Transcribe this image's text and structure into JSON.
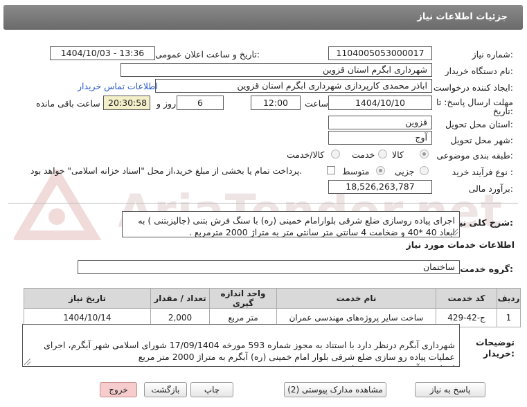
{
  "header": {
    "title": "جزئیات اطلاعات نیاز"
  },
  "watermark": {
    "text": "AriaTender.net"
  },
  "fields": {
    "need_number_label": "شماره نیاز:",
    "need_number": "1104005053000017",
    "announce_label": "تاریخ و ساعت اعلان عمومی:",
    "announce_value": "1404/10/03 - 13:36",
    "buyer_org_label": "نام دستگاه خریدار:",
    "buyer_org": "شهرداری ابگرم استان قزوین",
    "creator_label": "ایجاد کننده درخواست:",
    "creator": "اباذر محمدی کارپردازی شهرداری ابگرم استان قزوین",
    "contact_link": "اطلاعات تماس خریدار",
    "deadline_label_1": "مهلت ارسال پاسخ: تا",
    "deadline_label_2": "تاریخ:",
    "deadline_date": "1404/10/10",
    "time_label": "ساعت",
    "deadline_time": "12:00",
    "days_value": "6",
    "days_label": "روز و",
    "remaining_time": "20:30:58",
    "remaining_label": "ساعت باقی مانده",
    "province_label": "استان محل تحویل:",
    "province": "قزوین",
    "city_label": "شهر محل تحویل:",
    "city": "آوج",
    "category_label": "طبقه بندی موضوعی:",
    "category_options": [
      "کالا",
      "خدمت",
      "کالا/خدمت"
    ],
    "process_label": "نوع فرآیند خرید :",
    "process_options": [
      "جزیی",
      "متوسط"
    ],
    "payment_note": "پرداخت تمام یا بخشی از مبلغ خرید،از محل \"اسناد خزانه اسلامی\" خواهد بود.",
    "estimate_label": "برآورد مالی:",
    "estimate": "18,526,263,787"
  },
  "summary": {
    "label": "شرح کلی نیاز:",
    "text": "اجرای پیاده روسازی ضلع شرقی بلوارامام خمینی (ره) با سنگ فرش بتنی (جالیزبتنی ) به ابعاد 40 *40 و ضخامت 4 سانتی متر  سانتی متر به متراژ 2000 مترمربع ."
  },
  "services": {
    "section_title": "اطلاعات خدمات مورد نیاز",
    "group_label": "گروه خدمت:",
    "group_value": "ساختمان",
    "columns": [
      "ردیف",
      "کد خدمت",
      "نام خدمت",
      "واحد اندازه گیری",
      "تعداد / مقدار",
      "تاریخ نیاز"
    ],
    "rows": [
      [
        "1",
        "ج-42-429",
        "ساخت سایر پروژه‌های مهندسی عمران",
        "متر مربع",
        "2,000",
        "1404/10/14"
      ]
    ]
  },
  "buyer_notes": {
    "label_1": "توضیحات",
    "label_2": "خریدار:",
    "text": "شهرداری آبگرم درنظر دارد با استناد به مجوز شماره 593 مورخه 17/09/1404 شورای اسلامی شهر آبگرم، اجرای عملیات پیاده رو سازی ضلع شرقی بلوار امام خمینی (ره) آبگرم به متراژ 2000 متر مربع\nاسناد و برآورد به پیوست میباشد"
  },
  "buttons": {
    "reply": "پاسخ به نیاز",
    "attachments": "مشاهده مدارک پیوستی (2)",
    "print": "چاپ",
    "back": "بازگشت",
    "exit": "خروج"
  }
}
